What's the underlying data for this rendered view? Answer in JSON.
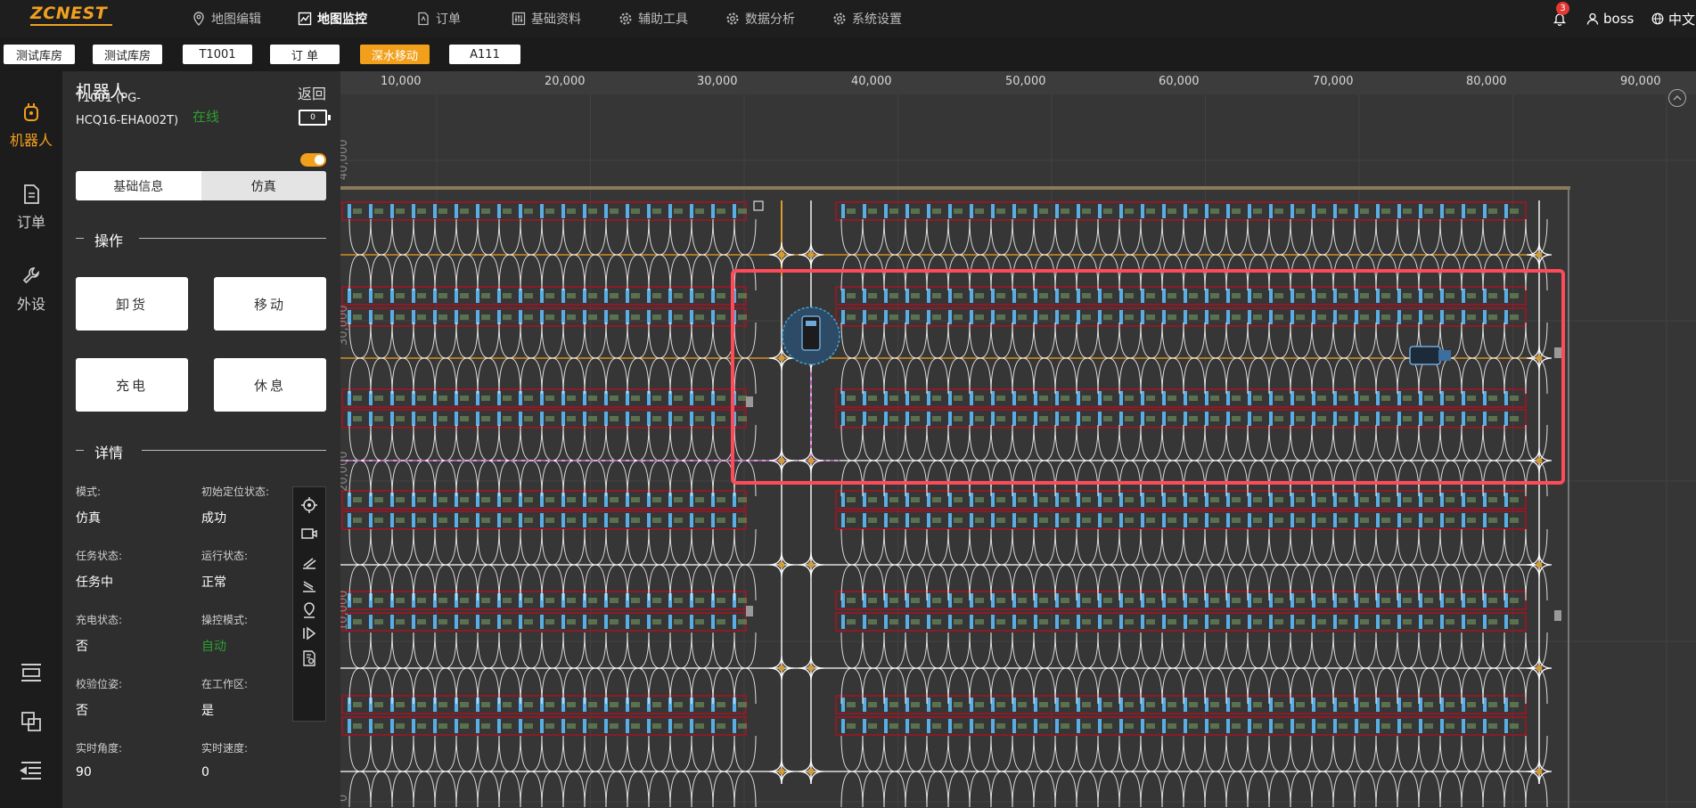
{
  "app": {
    "logo": "ZCNEST",
    "nav": [
      {
        "label": "地图编辑",
        "icon": "map-pin-icon"
      },
      {
        "label": "地图监控",
        "icon": "chart-line-icon",
        "active": true
      },
      {
        "label": "订单",
        "icon": "document-icon"
      },
      {
        "label": "基础资料",
        "icon": "sliders-icon"
      },
      {
        "label": "辅助工具",
        "icon": "gear-icon"
      },
      {
        "label": "数据分析",
        "icon": "gear-icon"
      },
      {
        "label": "系统设置",
        "icon": "gear-icon"
      }
    ],
    "notifications": "3",
    "user": "boss",
    "language": "中文"
  },
  "tabs": [
    {
      "label": "测试库房"
    },
    {
      "label": "测试库房"
    },
    {
      "label": "T1001"
    },
    {
      "label": "订 单"
    },
    {
      "label": "深水移动",
      "active": true
    },
    {
      "label": "A111"
    }
  ],
  "rail": {
    "items": [
      {
        "label": "机器人",
        "icon": "robot-icon",
        "active": true
      },
      {
        "label": "订单",
        "icon": "document-icon"
      },
      {
        "label": "外设",
        "icon": "wrench-icon"
      }
    ]
  },
  "robot_panel": {
    "title": "机器人",
    "back": "返回",
    "robot_name": "T1001 (PG-HCQ16-EHA002T)",
    "status": "在线",
    "battery": "0",
    "tabs": [
      "基础信息",
      "仿真"
    ],
    "ops_section": "操作",
    "ops": [
      "卸货",
      "移动",
      "充电",
      "休息"
    ],
    "details_section": "详情",
    "details": [
      {
        "label": "模式:",
        "value": "仿真"
      },
      {
        "label": "初始定位状态:",
        "value": "成功"
      },
      {
        "label": "任务状态:",
        "value": "任务中"
      },
      {
        "label": "运行状态:",
        "value": "正常"
      },
      {
        "label": "充电状态:",
        "value": "否"
      },
      {
        "label": "操控模式:",
        "value": "自动",
        "color": "#2e9e2e"
      },
      {
        "label": "校验位姿:",
        "value": "否"
      },
      {
        "label": "在工作区:",
        "value": "是"
      },
      {
        "label": "实时角度:",
        "value": "90"
      },
      {
        "label": "实时速度:",
        "value": "0"
      }
    ]
  },
  "map": {
    "x_ticks": [
      "10,000",
      "20,000",
      "30,000",
      "40,000",
      "50,000",
      "60,000",
      "70,000",
      "80,000",
      "90,000"
    ],
    "y_ticks": [
      "40,000",
      "30,000",
      "20,000",
      "10,000",
      "0"
    ],
    "colors": {
      "background": "#363636",
      "rack": "#b01020",
      "slot": "#5aaee6",
      "path": "#ffffff",
      "active_path": "#f2a01c",
      "highlight": "#ff4a5a",
      "dashed_route": "#d050d0"
    }
  }
}
